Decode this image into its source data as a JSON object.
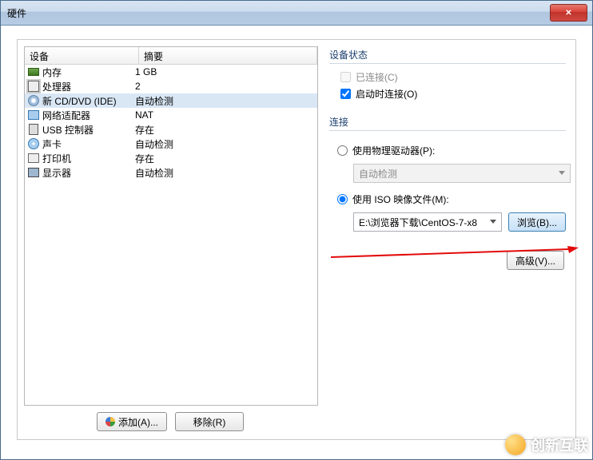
{
  "titlebar": {
    "title": "硬件"
  },
  "table": {
    "headers": {
      "device": "设备",
      "summary": "摘要"
    },
    "rows": [
      {
        "icon": "ic-mem",
        "name": "内存",
        "summary": "1 GB"
      },
      {
        "icon": "ic-cpu",
        "name": "处理器",
        "summary": "2"
      },
      {
        "icon": "ic-cd",
        "name": "新 CD/DVD (IDE)",
        "summary": "自动检测",
        "selected": true
      },
      {
        "icon": "ic-net",
        "name": "网络适配器",
        "summary": "NAT"
      },
      {
        "icon": "ic-usb",
        "name": "USB 控制器",
        "summary": "存在"
      },
      {
        "icon": "ic-snd",
        "name": "声卡",
        "summary": "自动检测"
      },
      {
        "icon": "ic-prn",
        "name": "打印机",
        "summary": "存在"
      },
      {
        "icon": "ic-disp",
        "name": "显示器",
        "summary": "自动检测"
      }
    ]
  },
  "right": {
    "status_label": "设备状态",
    "connected_label": "已连接(C)",
    "connect_on_power_label": "启动时连接(O)",
    "connect_label": "连接",
    "use_physical_label": "使用物理驱动器(P):",
    "physical_value": "自动检测",
    "use_iso_label": "使用 ISO 映像文件(M):",
    "iso_value": "E:\\浏览器下载\\CentOS-7-x8",
    "browse_label": "浏览(B)...",
    "advanced_label": "高级(V)..."
  },
  "bottom": {
    "add_label": "添加(A)...",
    "remove_label": "移除(R)"
  },
  "watermark": {
    "text": "创新互联"
  }
}
